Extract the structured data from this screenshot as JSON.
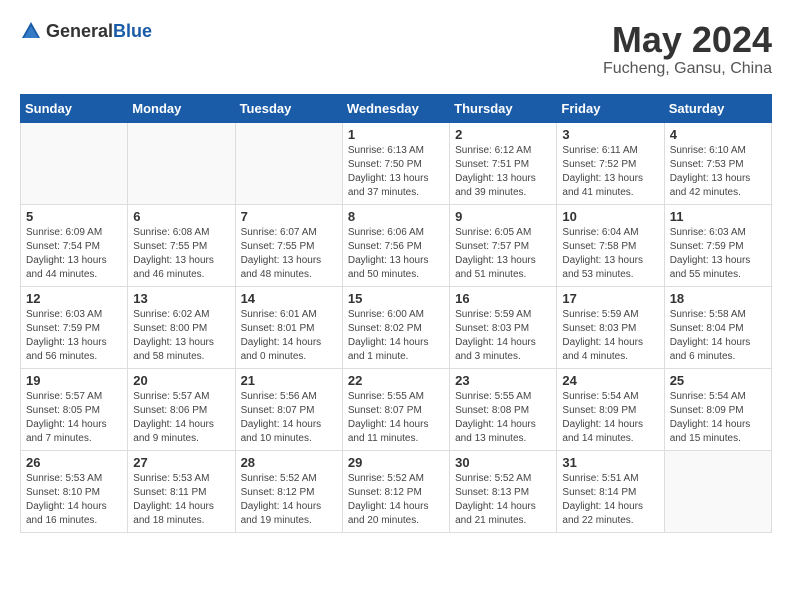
{
  "header": {
    "logo_general": "General",
    "logo_blue": "Blue",
    "title": "May 2024",
    "location": "Fucheng, Gansu, China"
  },
  "weekdays": [
    "Sunday",
    "Monday",
    "Tuesday",
    "Wednesday",
    "Thursday",
    "Friday",
    "Saturday"
  ],
  "weeks": [
    [
      {
        "day": "",
        "info": ""
      },
      {
        "day": "",
        "info": ""
      },
      {
        "day": "",
        "info": ""
      },
      {
        "day": "1",
        "info": "Sunrise: 6:13 AM\nSunset: 7:50 PM\nDaylight: 13 hours\nand 37 minutes."
      },
      {
        "day": "2",
        "info": "Sunrise: 6:12 AM\nSunset: 7:51 PM\nDaylight: 13 hours\nand 39 minutes."
      },
      {
        "day": "3",
        "info": "Sunrise: 6:11 AM\nSunset: 7:52 PM\nDaylight: 13 hours\nand 41 minutes."
      },
      {
        "day": "4",
        "info": "Sunrise: 6:10 AM\nSunset: 7:53 PM\nDaylight: 13 hours\nand 42 minutes."
      }
    ],
    [
      {
        "day": "5",
        "info": "Sunrise: 6:09 AM\nSunset: 7:54 PM\nDaylight: 13 hours\nand 44 minutes."
      },
      {
        "day": "6",
        "info": "Sunrise: 6:08 AM\nSunset: 7:55 PM\nDaylight: 13 hours\nand 46 minutes."
      },
      {
        "day": "7",
        "info": "Sunrise: 6:07 AM\nSunset: 7:55 PM\nDaylight: 13 hours\nand 48 minutes."
      },
      {
        "day": "8",
        "info": "Sunrise: 6:06 AM\nSunset: 7:56 PM\nDaylight: 13 hours\nand 50 minutes."
      },
      {
        "day": "9",
        "info": "Sunrise: 6:05 AM\nSunset: 7:57 PM\nDaylight: 13 hours\nand 51 minutes."
      },
      {
        "day": "10",
        "info": "Sunrise: 6:04 AM\nSunset: 7:58 PM\nDaylight: 13 hours\nand 53 minutes."
      },
      {
        "day": "11",
        "info": "Sunrise: 6:03 AM\nSunset: 7:59 PM\nDaylight: 13 hours\nand 55 minutes."
      }
    ],
    [
      {
        "day": "12",
        "info": "Sunrise: 6:03 AM\nSunset: 7:59 PM\nDaylight: 13 hours\nand 56 minutes."
      },
      {
        "day": "13",
        "info": "Sunrise: 6:02 AM\nSunset: 8:00 PM\nDaylight: 13 hours\nand 58 minutes."
      },
      {
        "day": "14",
        "info": "Sunrise: 6:01 AM\nSunset: 8:01 PM\nDaylight: 14 hours\nand 0 minutes."
      },
      {
        "day": "15",
        "info": "Sunrise: 6:00 AM\nSunset: 8:02 PM\nDaylight: 14 hours\nand 1 minute."
      },
      {
        "day": "16",
        "info": "Sunrise: 5:59 AM\nSunset: 8:03 PM\nDaylight: 14 hours\nand 3 minutes."
      },
      {
        "day": "17",
        "info": "Sunrise: 5:59 AM\nSunset: 8:03 PM\nDaylight: 14 hours\nand 4 minutes."
      },
      {
        "day": "18",
        "info": "Sunrise: 5:58 AM\nSunset: 8:04 PM\nDaylight: 14 hours\nand 6 minutes."
      }
    ],
    [
      {
        "day": "19",
        "info": "Sunrise: 5:57 AM\nSunset: 8:05 PM\nDaylight: 14 hours\nand 7 minutes."
      },
      {
        "day": "20",
        "info": "Sunrise: 5:57 AM\nSunset: 8:06 PM\nDaylight: 14 hours\nand 9 minutes."
      },
      {
        "day": "21",
        "info": "Sunrise: 5:56 AM\nSunset: 8:07 PM\nDaylight: 14 hours\nand 10 minutes."
      },
      {
        "day": "22",
        "info": "Sunrise: 5:55 AM\nSunset: 8:07 PM\nDaylight: 14 hours\nand 11 minutes."
      },
      {
        "day": "23",
        "info": "Sunrise: 5:55 AM\nSunset: 8:08 PM\nDaylight: 14 hours\nand 13 minutes."
      },
      {
        "day": "24",
        "info": "Sunrise: 5:54 AM\nSunset: 8:09 PM\nDaylight: 14 hours\nand 14 minutes."
      },
      {
        "day": "25",
        "info": "Sunrise: 5:54 AM\nSunset: 8:09 PM\nDaylight: 14 hours\nand 15 minutes."
      }
    ],
    [
      {
        "day": "26",
        "info": "Sunrise: 5:53 AM\nSunset: 8:10 PM\nDaylight: 14 hours\nand 16 minutes."
      },
      {
        "day": "27",
        "info": "Sunrise: 5:53 AM\nSunset: 8:11 PM\nDaylight: 14 hours\nand 18 minutes."
      },
      {
        "day": "28",
        "info": "Sunrise: 5:52 AM\nSunset: 8:12 PM\nDaylight: 14 hours\nand 19 minutes."
      },
      {
        "day": "29",
        "info": "Sunrise: 5:52 AM\nSunset: 8:12 PM\nDaylight: 14 hours\nand 20 minutes."
      },
      {
        "day": "30",
        "info": "Sunrise: 5:52 AM\nSunset: 8:13 PM\nDaylight: 14 hours\nand 21 minutes."
      },
      {
        "day": "31",
        "info": "Sunrise: 5:51 AM\nSunset: 8:14 PM\nDaylight: 14 hours\nand 22 minutes."
      },
      {
        "day": "",
        "info": ""
      }
    ]
  ]
}
